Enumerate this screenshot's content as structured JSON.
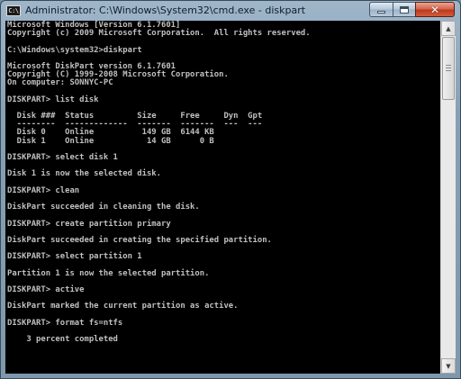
{
  "window": {
    "title": "Administrator: C:\\Windows\\System32\\cmd.exe - diskpart",
    "icon_text": "C:\\",
    "minimize": "minimize-icon",
    "maximize": "maximize-icon",
    "close": "✕"
  },
  "console": {
    "lines": [
      "Microsoft Windows [Version 6.1.7601]",
      "Copyright (c) 2009 Microsoft Corporation.  All rights reserved.",
      "",
      "C:\\Windows\\system32>diskpart",
      "",
      "Microsoft DiskPart version 6.1.7601",
      "Copyright (C) 1999-2008 Microsoft Corporation.",
      "On computer: SONNYC-PC",
      "",
      "DISKPART> list disk",
      "",
      "  Disk ###  Status         Size     Free     Dyn  Gpt",
      "  --------  -------------  -------  -------  ---  ---",
      "  Disk 0    Online          149 GB  6144 KB",
      "  Disk 1    Online           14 GB      0 B",
      "",
      "DISKPART> select disk 1",
      "",
      "Disk 1 is now the selected disk.",
      "",
      "DISKPART> clean",
      "",
      "DiskPart succeeded in cleaning the disk.",
      "",
      "DISKPART> create partition primary",
      "",
      "DiskPart succeeded in creating the specified partition.",
      "",
      "DISKPART> select partition 1",
      "",
      "Partition 1 is now the selected partition.",
      "",
      "DISKPART> active",
      "",
      "DiskPart marked the current partition as active.",
      "",
      "DISKPART> format fs=ntfs",
      "",
      "    3 percent completed",
      "",
      "",
      ""
    ]
  },
  "scrollbar": {
    "up_arrow": "▲",
    "down_arrow": "▼"
  },
  "colors": {
    "console_bg": "#000000",
    "console_fg": "#c0c0c0",
    "close_button": "#c0391d"
  }
}
